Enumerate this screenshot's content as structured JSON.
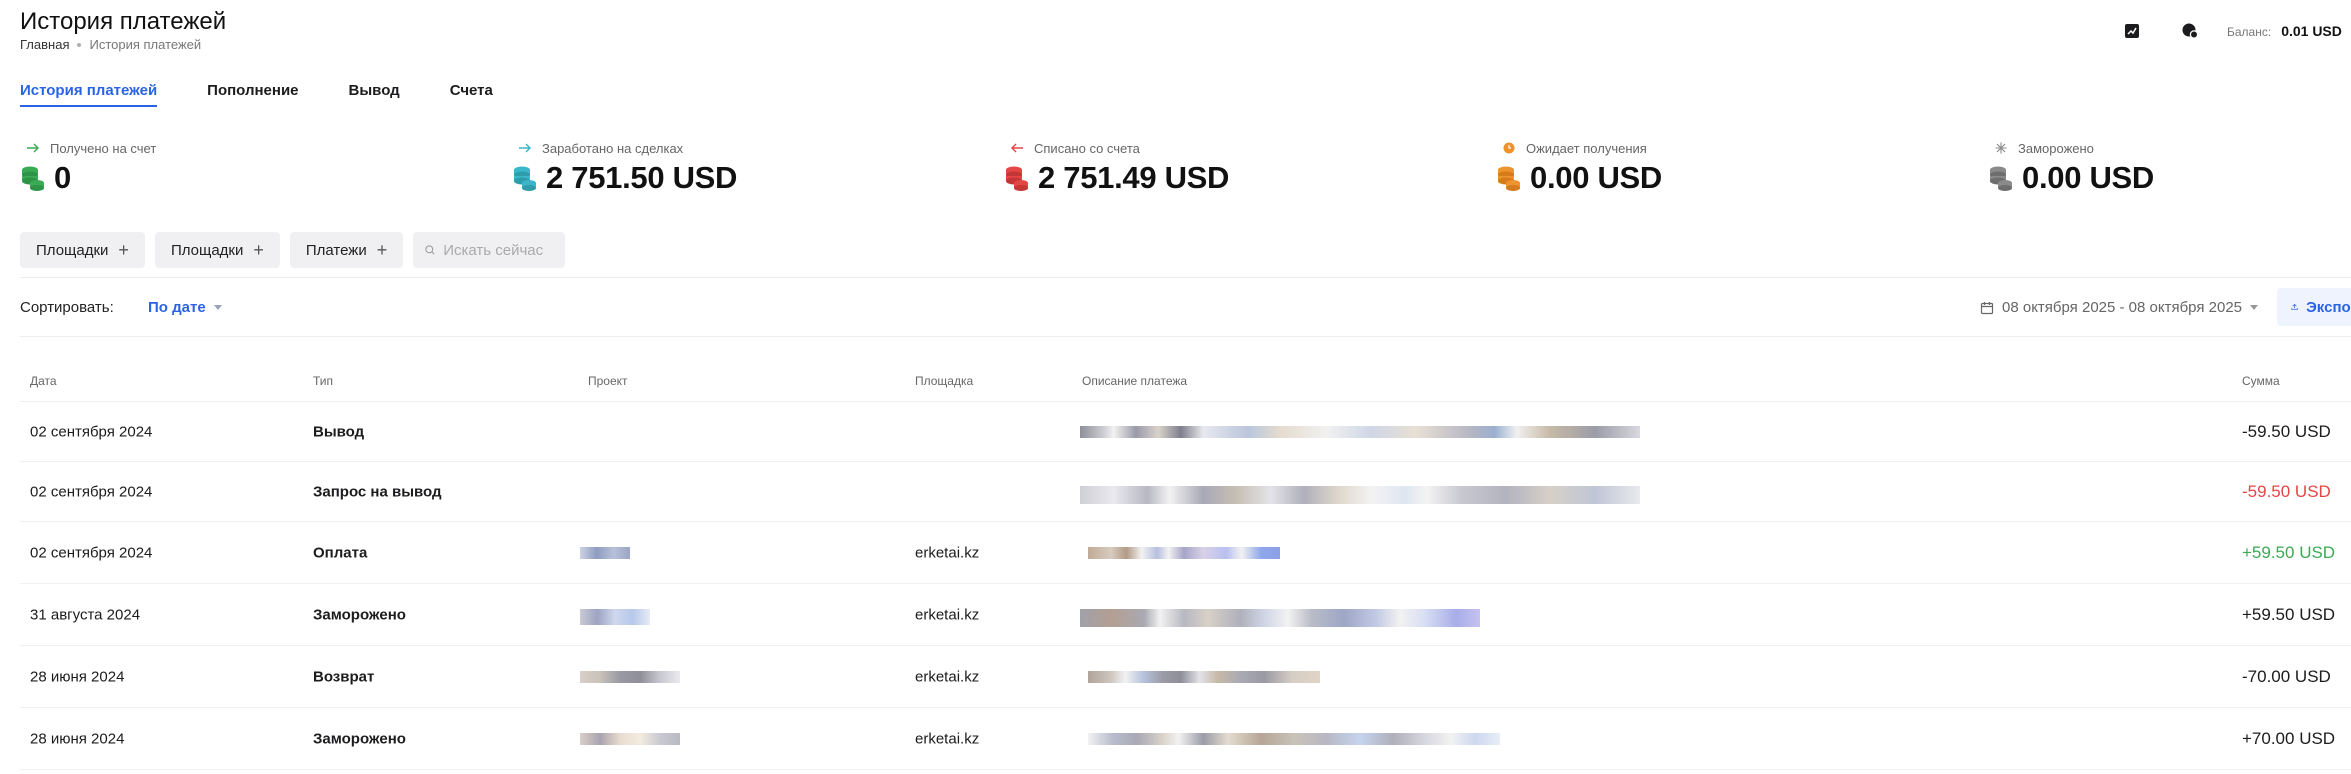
{
  "header": {
    "title": "История платежей",
    "breadcrumb": {
      "home": "Главная",
      "current": "История платежей"
    },
    "balance_label": "Баланс:",
    "balance_value": "0.01 USD"
  },
  "tabs": [
    {
      "label": "История платежей",
      "active": true
    },
    {
      "label": "Пополнение",
      "active": false
    },
    {
      "label": "Вывод",
      "active": false
    },
    {
      "label": "Счета",
      "active": false
    }
  ],
  "stats": [
    {
      "label": "Получено на счет",
      "value": "0",
      "color": "#3aaa55",
      "icon": "arrow-right-icon"
    },
    {
      "label": "Заработано на сделках",
      "value": "2 751.50 USD",
      "color": "#3bb7c9",
      "icon": "arrow-right-icon"
    },
    {
      "label": "Списано со счета",
      "value": "2 751.49 USD",
      "color": "#e64545",
      "icon": "arrow-left-icon"
    },
    {
      "label": "Ожидает получения",
      "value": "0.00 USD",
      "color": "#f0922e",
      "icon": "clock-icon"
    },
    {
      "label": "Заморожено",
      "value": "0.00 USD",
      "color": "#8a8a8a",
      "icon": "snowflake-icon"
    }
  ],
  "filters": {
    "chips": [
      "Площадки",
      "Площадки",
      "Платежи"
    ],
    "search_placeholder": "Искать сейчас"
  },
  "sort": {
    "label": "Сортировать:",
    "value": "По дате",
    "date_range": "08 октября 2025 - 08 октября 2025",
    "export_label": "Экспорт"
  },
  "table": {
    "columns": [
      "Дата",
      "Тип",
      "Проект",
      "Площадка",
      "Описание платежа",
      "Сумма"
    ],
    "rows": [
      {
        "date": "02 сентября 2024",
        "type": "Вывод",
        "platform": "",
        "amount": "-59.50 USD",
        "amount_color": "#1c1c1e"
      },
      {
        "date": "02 сентября 2024",
        "type": "Запрос на вывод",
        "platform": "",
        "amount": "-59.50 USD",
        "amount_color": "#e64545"
      },
      {
        "date": "02 сентября 2024",
        "type": "Оплата",
        "platform": "erketai.kz",
        "amount": "+59.50 USD",
        "amount_color": "#3aaa55"
      },
      {
        "date": "31 августа 2024",
        "type": "Заморожено",
        "platform": "erketai.kz",
        "amount": "+59.50 USD",
        "amount_color": "#1c1c1e"
      },
      {
        "date": "28 июня 2024",
        "type": "Возврат",
        "platform": "erketai.kz",
        "amount": "-70.00 USD",
        "amount_color": "#1c1c1e"
      },
      {
        "date": "28 июня 2024",
        "type": "Заморожено",
        "platform": "erketai.kz",
        "amount": "+70.00 USD",
        "amount_color": "#1c1c1e"
      }
    ]
  }
}
